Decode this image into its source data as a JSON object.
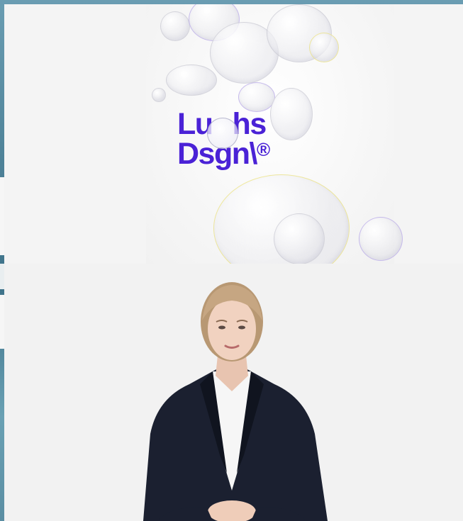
{
  "artwork": {
    "wordmark_line1": "Lu",
    "wordmark_line1_tail": "hs",
    "wordmark_line2": "Dsgn\\",
    "wordmark_reg": "®"
  },
  "colors": {
    "brand": "#4a22d6",
    "panel_background": "#f3f3f3",
    "jacket": "#1a1f2e",
    "backdrop": "#5b8ea3"
  },
  "icons": {
    "wordmark_lens": "glass-bubble",
    "presenter": "person-presenter"
  }
}
